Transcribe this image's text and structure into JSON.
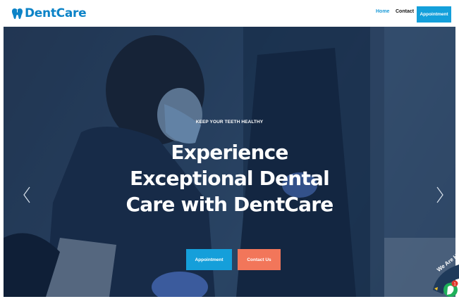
{
  "brand": {
    "name": "DentCare",
    "color": "#0C83C7",
    "icon": "tooth-icon"
  },
  "nav": {
    "home": "Home",
    "contact": "Contact",
    "appointment": "Appointment",
    "active_color": "#1B9BD8",
    "button_color": "#14A0DB"
  },
  "hero": {
    "eyebrow": "KEEP YOUR TEETH HEALTHY",
    "title_line1": "Experience",
    "title_line2": "Exceptional Dental",
    "title_line3": "Care with DentCare",
    "primary_button": "Appointment",
    "secondary_button": "Contact Us",
    "primary_color": "#159FDA",
    "secondary_color": "#F2765A",
    "prev_icon": "chevron-left-icon",
    "next_icon": "chevron-right-icon"
  },
  "badge": {
    "text": "We Are Here",
    "icon": "whatsapp-icon",
    "notification_count": "1"
  }
}
